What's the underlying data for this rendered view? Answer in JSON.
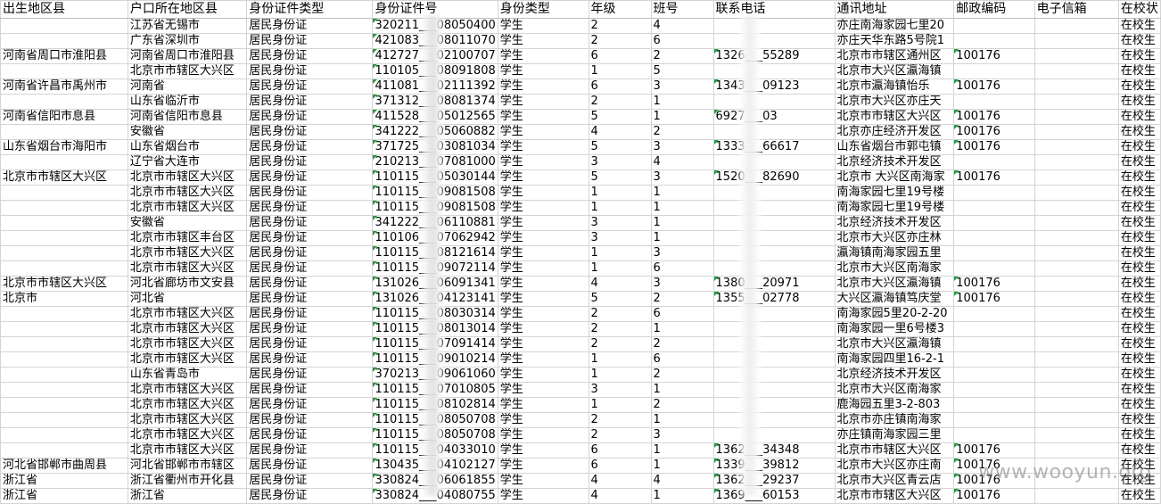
{
  "columns": [
    "出生地区县",
    "户口所在地区县",
    "身份证件类型",
    "身份证件号",
    "身份类型",
    "年级",
    "班号",
    "联系电话",
    "通讯地址",
    "邮政编码",
    "电子信箱",
    "在校状"
  ],
  "rows": [
    [
      "",
      "江苏省无锡市",
      "居民身份证",
      "320211___08050400",
      "学生",
      "2",
      "4",
      "",
      "亦庄南海家园七里20",
      "",
      "",
      "在校生"
    ],
    [
      "",
      "广东省深圳市",
      "居民身份证",
      "421083___08011070",
      "学生",
      "2",
      "6",
      "",
      "亦庄天华东路5号院1",
      "",
      "",
      "在校生"
    ],
    [
      "河南省周口市淮阳县",
      "河南省周口市淮阳县",
      "居民身份证",
      "412727___02100707",
      "学生",
      "6",
      "2",
      "1326___55289",
      "北京市市辖区通州区",
      "100176",
      "",
      "在校生"
    ],
    [
      "",
      "北京市市辖区大兴区",
      "居民身份证",
      "110105___08091808",
      "学生",
      "1",
      "5",
      "",
      "北京市大兴区瀛海镇",
      "",
      "",
      "在校生"
    ],
    [
      "河南省许昌市禹州市",
      "河南省",
      "居民身份证",
      "411081___02111392",
      "学生",
      "6",
      "3",
      "1343___09123",
      "北京市瀛海镇怡乐",
      "100176",
      "",
      "在校生"
    ],
    [
      "",
      "山东省临沂市",
      "居民身份证",
      "371312___08081374",
      "学生",
      "2",
      "1",
      "",
      "北京市大兴区亦庄天",
      "",
      "",
      "在校生"
    ],
    [
      "河南省信阳市息县",
      "河南省信阳市息县",
      "居民身份证",
      "411528___05012565",
      "学生",
      "5",
      "1",
      "6927___03",
      "北京市市辖区大兴区",
      "100176",
      "",
      "在校生"
    ],
    [
      "",
      "安徽省",
      "居民身份证",
      "341222___05060882",
      "学生",
      "4",
      "2",
      "",
      "北京亦庄经济开发区",
      "100176",
      "",
      "在校生"
    ],
    [
      "山东省烟台市海阳市",
      "山东省烟台市",
      "居民身份证",
      "371725___03081034",
      "学生",
      "5",
      "3",
      "1333___66617",
      "山东省烟台市郭屯镇",
      "100176",
      "",
      "在校生"
    ],
    [
      "",
      "辽宁省大连市",
      "居民身份证",
      "210213___07081000",
      "学生",
      "3",
      "4",
      "",
      "北京经济技术开发区",
      "",
      "",
      "在校生"
    ],
    [
      "北京市市辖区大兴区",
      "北京市市辖区大兴区",
      "居民身份证",
      "110115___05030144",
      "学生",
      "5",
      "3",
      "1520___82690",
      "北京市  大兴区南海家",
      "100176",
      "",
      "在校生"
    ],
    [
      "",
      "北京市市辖区大兴区",
      "居民身份证",
      "110115___09081508",
      "学生",
      "1",
      "1",
      "",
      "南海家园七里19号楼",
      "",
      "",
      "在校生"
    ],
    [
      "",
      "北京市市辖区大兴区",
      "居民身份证",
      "110115___09081508",
      "学生",
      "1",
      "1",
      "",
      "南海家园七里19号楼",
      "",
      "",
      "在校生"
    ],
    [
      "",
      "安徽省",
      "居民身份证",
      "341222___06110881",
      "学生",
      "3",
      "1",
      "",
      "北京经济技术开发区",
      "",
      "",
      "在校生"
    ],
    [
      "",
      "北京市市辖区丰台区",
      "居民身份证",
      "110106___07062942",
      "学生",
      "3",
      "1",
      "",
      "北京市大兴区亦庄林",
      "",
      "",
      "在校生"
    ],
    [
      "",
      "北京市市辖区大兴区",
      "居民身份证",
      "110115___08121614",
      "学生",
      "1",
      "3",
      "",
      "瀛海镇南海家园五里",
      "",
      "",
      "在校生"
    ],
    [
      "",
      "北京市市辖区大兴区",
      "居民身份证",
      "110115___09072114",
      "学生",
      "1",
      "6",
      "",
      "北京市大兴区南海家",
      "",
      "",
      "在校生"
    ],
    [
      "北京市市辖区大兴区",
      "河北省廊坊市文安县",
      "居民身份证",
      "131026___06091341",
      "学生",
      "4",
      "3",
      "1380___20971",
      "北京市大兴区瀛海镇",
      "100176",
      "",
      "在校生"
    ],
    [
      "北京市",
      "河北省",
      "居民身份证",
      "131026___04123141",
      "学生",
      "5",
      "2",
      "1355___02778",
      "大兴区瀛海镇笃庆堂",
      "100176",
      "",
      "在校生"
    ],
    [
      "",
      "北京市市辖区大兴区",
      "居民身份证",
      "110115___08030314",
      "学生",
      "2",
      "6",
      "",
      "南海家园5里20-2-20",
      "",
      "",
      "在校生"
    ],
    [
      "",
      "北京市市辖区大兴区",
      "居民身份证",
      "110115___08013014",
      "学生",
      "2",
      "1",
      "",
      "南海家园一里6号楼3",
      "",
      "",
      "在校生"
    ],
    [
      "",
      "北京市市辖区大兴区",
      "居民身份证",
      "110115___07091414",
      "学生",
      "2",
      "2",
      "",
      "北京市大兴区瀛海镇",
      "",
      "",
      "在校生"
    ],
    [
      "",
      "北京市市辖区大兴区",
      "居民身份证",
      "110115___09010214",
      "学生",
      "1",
      "6",
      "",
      "南海家园四里16-2-1",
      "",
      "",
      "在校生"
    ],
    [
      "",
      "山东省青岛市",
      "居民身份证",
      "370213___09061060",
      "学生",
      "1",
      "2",
      "",
      "北京经济技术开发区",
      "",
      "",
      "在校生"
    ],
    [
      "",
      "北京市市辖区大兴区",
      "居民身份证",
      "110115___07010805",
      "学生",
      "3",
      "1",
      "",
      "北京市大兴区南海家",
      "",
      "",
      "在校生"
    ],
    [
      "",
      "北京市市辖区大兴区",
      "居民身份证",
      "110115___08102814",
      "学生",
      "1",
      "2",
      "",
      "鹿海园五里3-2-803",
      "",
      "",
      "在校生"
    ],
    [
      "",
      "北京市市辖区大兴区",
      "居民身份证",
      "110115___08050708",
      "学生",
      "2",
      "1",
      "",
      "北京市亦庄镇南海家",
      "",
      "",
      "在校生"
    ],
    [
      "",
      "北京市市辖区大兴区",
      "居民身份证",
      "110115___08050708",
      "学生",
      "2",
      "3",
      "",
      "亦庄镇南海家园三里",
      "",
      "",
      "在校生"
    ],
    [
      "",
      "北京市市辖区大兴区",
      "居民身份证",
      "110115___04033010",
      "学生",
      "6",
      "1",
      "1362___34348",
      "北京市市辖区大兴区",
      "100176",
      "",
      "在校生"
    ],
    [
      "河北省邯郸市曲周县",
      "河北省邯郸市市辖区",
      "居民身份证",
      "130435___04102127",
      "学生",
      "6",
      "1",
      "1339___39812",
      "北京市大兴区亦庄南",
      "100176",
      "",
      "在校生"
    ],
    [
      "浙江省",
      "浙江省衢州市开化县",
      "居民身份证",
      "330824___06061855",
      "学生",
      "4",
      "4",
      "1362___29237",
      "北京市大兴区青云店",
      "100176",
      "",
      "在校生"
    ],
    [
      "浙江省",
      "浙江省",
      "居民身份证",
      "330824___04080755",
      "学生",
      "4",
      "1",
      "1369___60153",
      "北京市市辖区大兴区",
      "100176",
      "",
      "在校生"
    ]
  ],
  "text_cells": {
    "id_col": 3,
    "phone_col": 7,
    "zip_col": 9
  },
  "watermark": "www.wooyun.org",
  "colors": {
    "text_marker": "#1e9e3a",
    "gridline": "#d4d4d4"
  }
}
